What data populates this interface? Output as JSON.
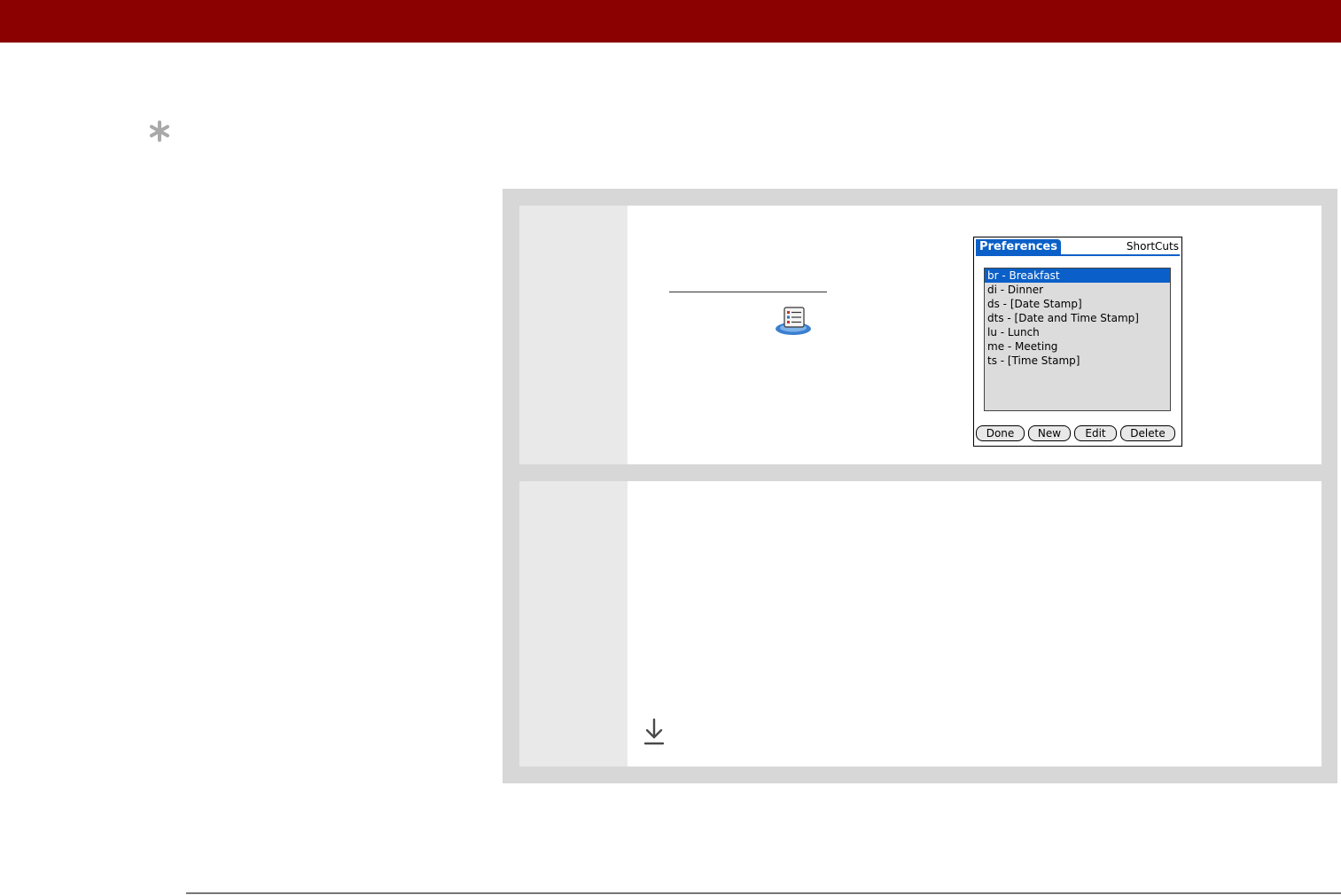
{
  "icons": {
    "tip": "asterisk-icon",
    "app": "preferences-app-icon",
    "continue": "down-arrow-icon"
  },
  "colors": {
    "header_bar": "#8b0000",
    "panel_bg": "#d7d7d7",
    "step_number_bg": "#e9e9e9",
    "palm_highlight": "#0a60c8"
  },
  "palm_screen": {
    "title": "Preferences",
    "panel": "ShortCuts",
    "items": [
      "br - Breakfast",
      "di - Dinner",
      "ds - [Date Stamp]",
      "dts - [Date and Time Stamp]",
      "lu - Lunch",
      "me - Meeting",
      "ts - [Time Stamp]"
    ],
    "selected_index": 0,
    "buttons": {
      "done": "Done",
      "new": "New",
      "edit": "Edit",
      "delete": "Delete"
    }
  }
}
